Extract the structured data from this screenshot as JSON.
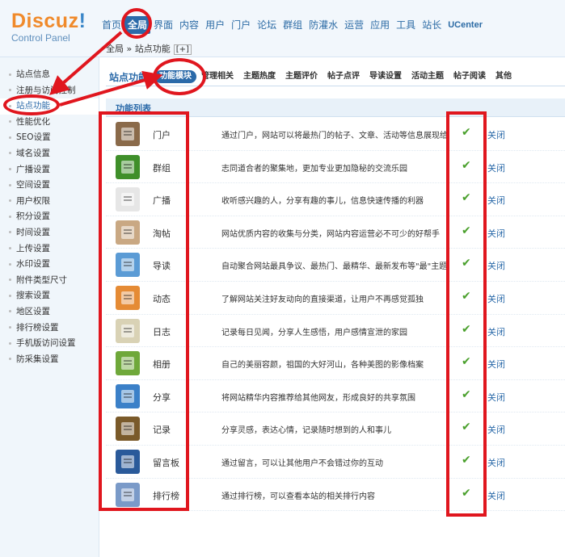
{
  "logo": {
    "name": "Discuz",
    "bang": "!",
    "subtitle": "Control Panel"
  },
  "topnav": [
    {
      "label": "首页",
      "active": false
    },
    {
      "label": "全局",
      "active": true
    },
    {
      "label": "界面",
      "active": false
    },
    {
      "label": "内容",
      "active": false
    },
    {
      "label": "用户",
      "active": false
    },
    {
      "label": "门户",
      "active": false
    },
    {
      "label": "论坛",
      "active": false
    },
    {
      "label": "群组",
      "active": false
    },
    {
      "label": "防灌水",
      "active": false
    },
    {
      "label": "运营",
      "active": false
    },
    {
      "label": "应用",
      "active": false
    },
    {
      "label": "工具",
      "active": false
    },
    {
      "label": "站长",
      "active": false
    },
    {
      "label": "UCenter",
      "active": false
    }
  ],
  "breadcrumb": {
    "text": "全局 » 站点功能",
    "plus": "[+]"
  },
  "sidebar": {
    "items": [
      {
        "label": "站点信息",
        "active": false
      },
      {
        "label": "注册与访问控制",
        "active": false
      },
      {
        "label": "站点功能",
        "active": true
      },
      {
        "label": "性能优化",
        "active": false
      },
      {
        "label": "SEO设置",
        "active": false
      },
      {
        "label": "域名设置",
        "active": false
      },
      {
        "label": "广播设置",
        "active": false
      },
      {
        "label": "空间设置",
        "active": false
      },
      {
        "label": "用户权限",
        "active": false
      },
      {
        "label": "积分设置",
        "active": false
      },
      {
        "label": "时间设置",
        "active": false
      },
      {
        "label": "上传设置",
        "active": false
      },
      {
        "label": "水印设置",
        "active": false
      },
      {
        "label": "附件类型尺寸",
        "active": false
      },
      {
        "label": "搜索设置",
        "active": false
      },
      {
        "label": "地区设置",
        "active": false
      },
      {
        "label": "排行榜设置",
        "active": false
      },
      {
        "label": "手机版访问设置",
        "active": false
      },
      {
        "label": "防采集设置",
        "active": false
      }
    ]
  },
  "subtabs": {
    "title": "站点功能",
    "items": [
      {
        "label": "功能模块",
        "active": true
      },
      {
        "label": "管理相关",
        "active": false
      },
      {
        "label": "主题热度",
        "active": false
      },
      {
        "label": "主题评价",
        "active": false
      },
      {
        "label": "帖子点评",
        "active": false
      },
      {
        "label": "导读设置",
        "active": false
      },
      {
        "label": "活动主题",
        "active": false
      },
      {
        "label": "帖子阅读",
        "active": false
      },
      {
        "label": "其他",
        "active": false
      }
    ]
  },
  "list": {
    "header": "功能列表",
    "close_label": "关闭",
    "check_glyph": "✔",
    "rows": [
      {
        "icon": "portal-icon",
        "name": "门户",
        "desc": "通过门户，网站可以将最热门的帖子、文章、活动等信息展现给用户",
        "color": "#8a6a4a"
      },
      {
        "icon": "group-icon",
        "name": "群组",
        "desc": "志同道合者的聚集地，更加专业更加隐秘的交流乐园",
        "color": "#3f8f2a"
      },
      {
        "icon": "broadcast-icon",
        "name": "广播",
        "desc": "收听感兴趣的人，分享有趣的事儿，信息快速传播的利器",
        "color": "#e6e6e6"
      },
      {
        "icon": "taotie-icon",
        "name": "淘帖",
        "desc": "网站优质内容的收集与分类，网站内容运营必不可少的好帮手",
        "color": "#c9a883"
      },
      {
        "icon": "guide-icon",
        "name": "导读",
        "desc": "自动聚合网站最具争议、最热门、最精华、最新发布等\"最\"主题",
        "color": "#5b9bd5"
      },
      {
        "icon": "feed-icon",
        "name": "动态",
        "desc": "了解网站关注好友动向的直接渠道，让用户不再感觉孤独",
        "color": "#e58b35"
      },
      {
        "icon": "blog-icon",
        "name": "日志",
        "desc": "记录每日见闻，分享人生感悟，用户感情宣泄的家园",
        "color": "#d9d2b5"
      },
      {
        "icon": "album-icon",
        "name": "相册",
        "desc": "自己的美丽容颜，祖国的大好河山，各种美图的影像档案",
        "color": "#6fa83a"
      },
      {
        "icon": "share-icon",
        "name": "分享",
        "desc": "将网站精华内容推荐给其他网友，形成良好的共享氛围",
        "color": "#3b80c8"
      },
      {
        "icon": "doing-icon",
        "name": "记录",
        "desc": "分享灵感，表达心情，记录随时想到的人和事儿",
        "color": "#7a5a2a"
      },
      {
        "icon": "guestbook-icon",
        "name": "留言板",
        "desc": "通过留言，可以让其他用户不会错过你的互动",
        "color": "#2a5a9a"
      },
      {
        "icon": "ranklist-icon",
        "name": "排行榜",
        "desc": "通过排行榜，可以查看本站的相关排行内容",
        "color": "#7a9ac8"
      }
    ]
  },
  "annotation_color": "#e0161e"
}
